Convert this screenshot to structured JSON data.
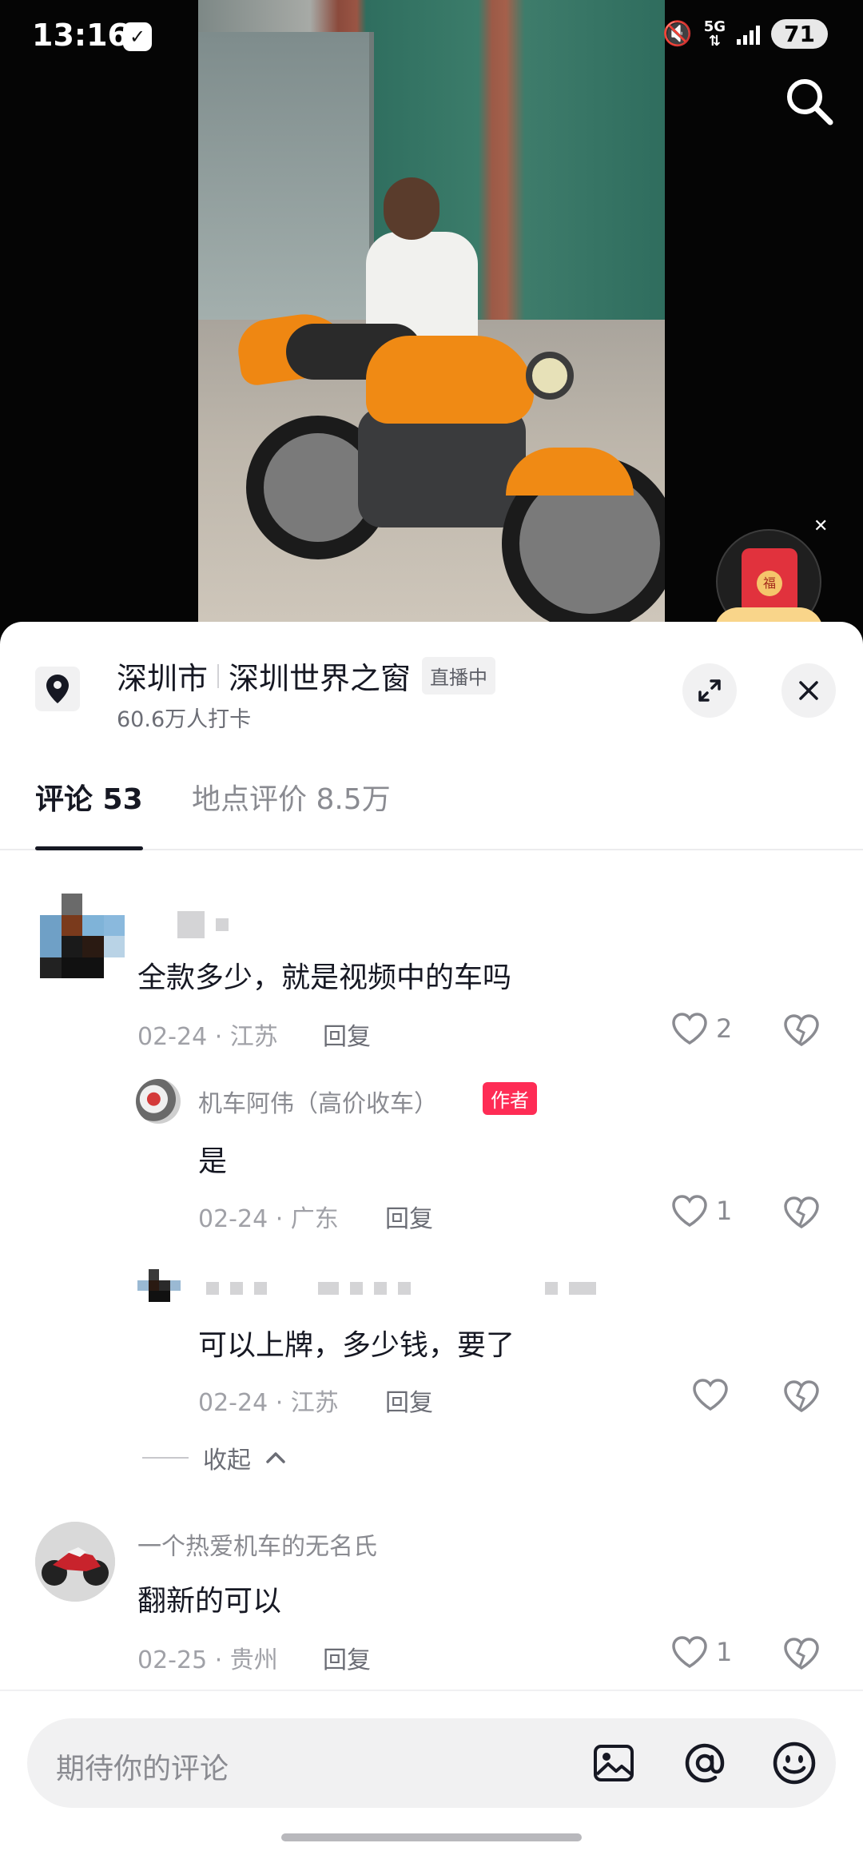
{
  "status_bar": {
    "time": "13:16",
    "network": "5G",
    "battery": "71"
  },
  "location": {
    "city": "深圳市",
    "place": "深圳世界之窗",
    "live_badge": "直播中",
    "checkins": "60.6万人打卡"
  },
  "tabs": [
    {
      "label": "评论 53",
      "active": true
    },
    {
      "label": "地点评价 8.5万",
      "active": false
    }
  ],
  "comments": [
    {
      "text": "全款多少，就是视频中的车吗",
      "date": "02-24",
      "region": "江苏",
      "reply_label": "回复",
      "likes": "2",
      "replies": [
        {
          "name": "机车阿伟（高价收车）",
          "badge": "作者",
          "text": "是",
          "date": "02-24",
          "region": "广东",
          "reply_label": "回复",
          "likes": "1"
        },
        {
          "text": "可以上牌，多少钱，要了",
          "date": "02-24",
          "region": "江苏",
          "reply_label": "回复",
          "likes": ""
        }
      ],
      "collapse_label": "收起"
    },
    {
      "name": "一个热爱机车的无名氏",
      "text": "翻新的可以",
      "date": "02-25",
      "region": "贵州",
      "reply_label": "回复",
      "likes": "1"
    }
  ],
  "input": {
    "placeholder": "期待你的评论"
  },
  "colors": {
    "accent": "#fe2c55",
    "text_primary": "#161823",
    "text_secondary": "#8a8b91"
  },
  "icons": [
    "search-icon",
    "location-pin-icon",
    "expand-icon",
    "close-icon",
    "heart-icon",
    "dislike-heart-icon",
    "image-icon",
    "at-icon",
    "emoji-icon",
    "red-packet-icon",
    "chevron-up-icon"
  ]
}
